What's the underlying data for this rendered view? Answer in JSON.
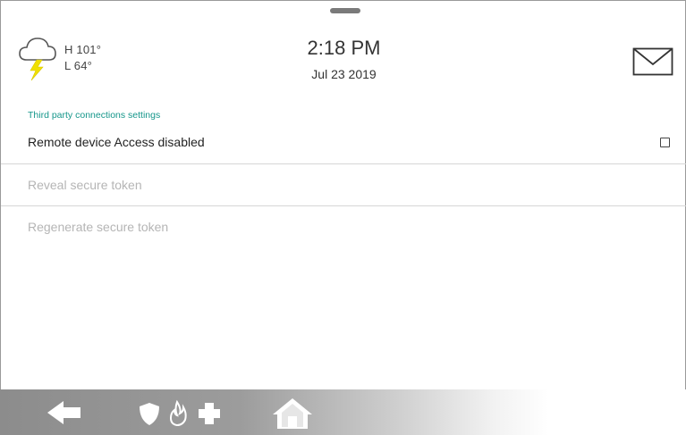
{
  "header": {
    "weather": {
      "high": "H 101°",
      "low": "L 64°",
      "icon": "thunderstorm-cloud-icon"
    },
    "time": "2:18 PM",
    "date": "Jul 23 2019",
    "message_icon": "envelope-icon"
  },
  "settings": {
    "section_title": "Third party connections settings",
    "remote_access": {
      "label": "Remote device Access disabled",
      "checked": false
    },
    "reveal_token": {
      "label": "Reveal secure token",
      "enabled": false
    },
    "regenerate_token": {
      "label": "Regenerate secure token",
      "enabled": false
    }
  },
  "nav": {
    "icons": [
      "back-arrow-icon",
      "shield-icon",
      "fire-icon",
      "plus-icon",
      "home-icon"
    ]
  },
  "colors": {
    "accent": "#14968a",
    "disabled_text": "#b5b5b5",
    "navbar_gray": "#8c8c8c"
  }
}
